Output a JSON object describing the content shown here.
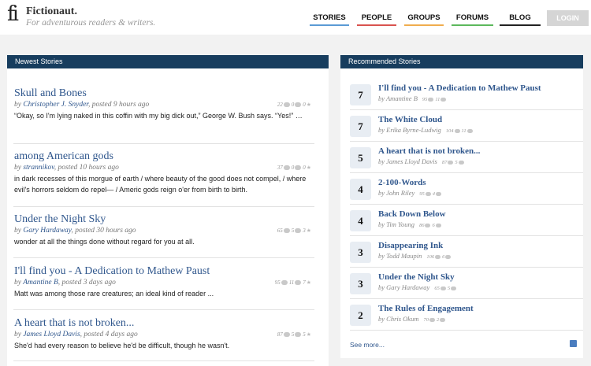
{
  "header": {
    "logo": "fi",
    "site_name": "Fictionaut.",
    "tagline": "For adventurous readers & writers.",
    "nav": [
      {
        "label": "STORIES",
        "color": "#5b9bd5"
      },
      {
        "label": "PEOPLE",
        "color": "#d9534f"
      },
      {
        "label": "GROUPS",
        "color": "#f0ad4e"
      },
      {
        "label": "FORUMS",
        "color": "#5cb85c"
      },
      {
        "label": "BLOG",
        "color": "#222222"
      }
    ],
    "login": "LOGIN"
  },
  "newest": {
    "heading": "Newest Stories",
    "stories": [
      {
        "title": "Skull and Bones",
        "by": "by",
        "author": "Christopher J. Snyder",
        "posted": ", posted 9 hours ago",
        "reads": "22",
        "comments": "0",
        "stars": "0",
        "excerpt": "“Okay, so I'm lying naked in this coffin with my big dick out,” George W. Bush says. “Yes!” …"
      },
      {
        "title": "among American gods",
        "by": "by",
        "author": "strannikov",
        "posted": ", posted 10 hours ago",
        "reads": "37",
        "comments": "0",
        "stars": "0",
        "excerpt": "in dark recesses of this morgue of earth / where beauty of the good does not compel, / where evil's horrors seldom do repel— / Americ gods reign o'er from birth to birth."
      },
      {
        "title": "Under the Night Sky",
        "by": "by",
        "author": "Gary Hardaway",
        "posted": ", posted 30 hours ago",
        "reads": "65",
        "comments": "5",
        "stars": "3",
        "excerpt": "wonder at all the things done without regard for you at all."
      },
      {
        "title": "I'll find you - A Dedication to Mathew Paust",
        "by": "by",
        "author": "Amantine B",
        "posted": ", posted 3 days ago",
        "reads": "95",
        "comments": "11",
        "stars": "7",
        "excerpt": "Matt was among those rare creatures; an ideal kind of reader ..."
      },
      {
        "title": "A heart that is not broken...",
        "by": "by",
        "author": "James Lloyd Davis",
        "posted": ", posted 4 days ago",
        "reads": "87",
        "comments": "5",
        "stars": "5",
        "excerpt": "She'd had every reason to believe he'd be difficult, though he wasn't."
      }
    ]
  },
  "recommended": {
    "heading": "Recommended Stories",
    "items": [
      {
        "rank": "7",
        "title": "I'll find you - A Dedication to Mathew Paust",
        "by": "by Amantine B",
        "reads": "95",
        "comments": "11"
      },
      {
        "rank": "7",
        "title": "The White Cloud",
        "by": "by Erika Byrne-Ludwig",
        "reads": "104",
        "comments": "11"
      },
      {
        "rank": "5",
        "title": "A heart that is not broken...",
        "by": "by James Lloyd Davis",
        "reads": "87",
        "comments": "5"
      },
      {
        "rank": "4",
        "title": "2-100-Words",
        "by": "by John Riley",
        "reads": "95",
        "comments": "4"
      },
      {
        "rank": "4",
        "title": "Back Down Below",
        "by": "by Tim Young",
        "reads": "86",
        "comments": "6"
      },
      {
        "rank": "3",
        "title": "Disappearing Ink",
        "by": "by Todd Maupin",
        "reads": "106",
        "comments": "6"
      },
      {
        "rank": "3",
        "title": "Under the Night Sky",
        "by": "by Gary Hardaway",
        "reads": "65",
        "comments": "5"
      },
      {
        "rank": "2",
        "title": "The Rules of Engagement",
        "by": "by Chris Okum",
        "reads": "70",
        "comments": "2"
      }
    ],
    "see_more": "See more..."
  }
}
